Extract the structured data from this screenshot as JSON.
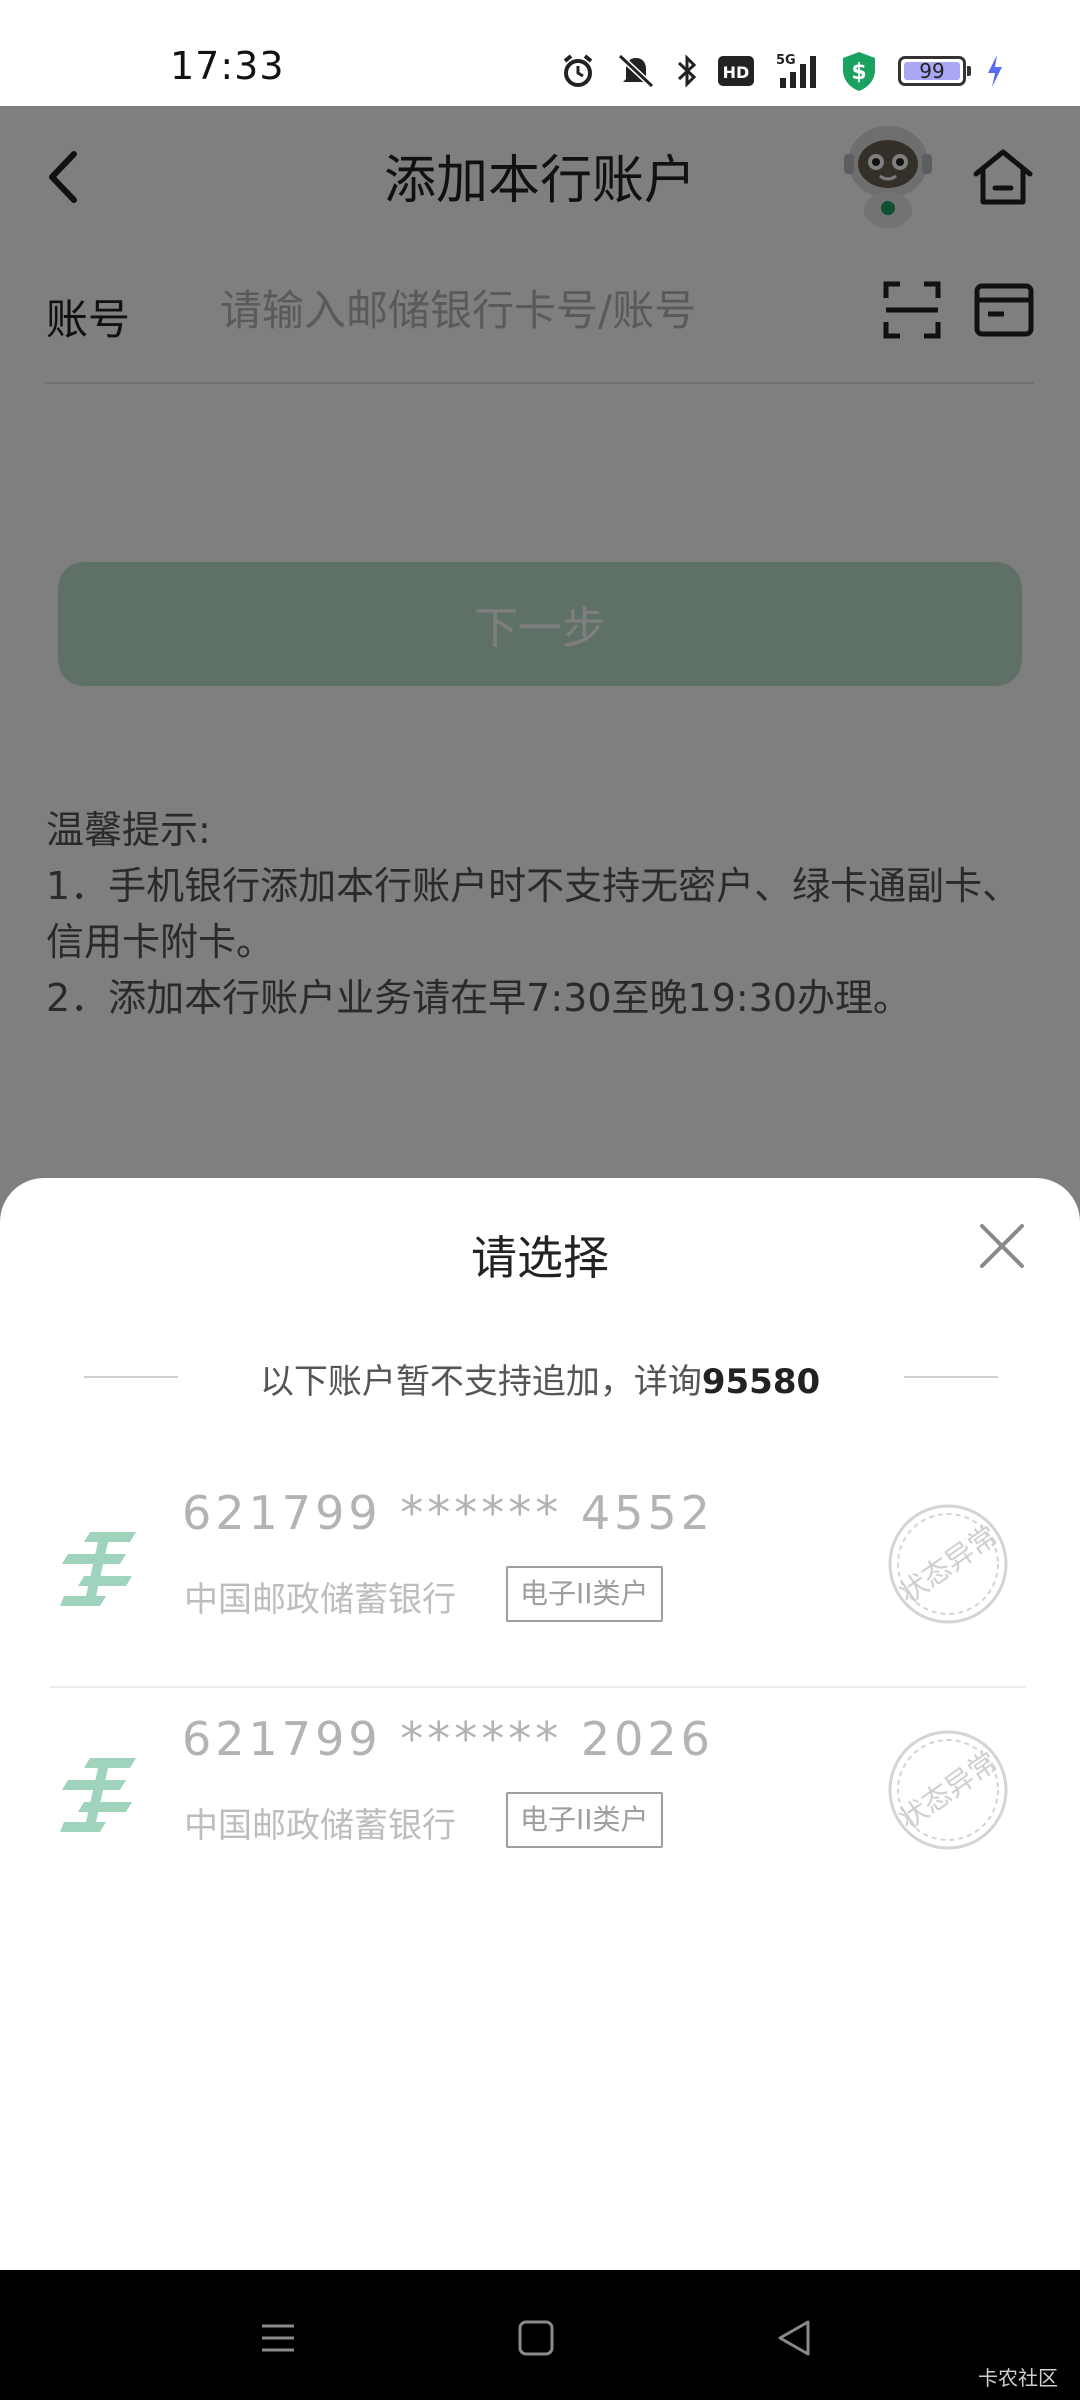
{
  "status_bar": {
    "time": "17:33",
    "network": "5G",
    "hd": "HD",
    "battery": "99",
    "icons": [
      "alarm-icon",
      "mute-icon",
      "bluetooth-icon",
      "hd-icon",
      "signal-icon",
      "shield-icon",
      "battery-icon",
      "charging-icon"
    ]
  },
  "nav": {
    "title": "添加本行账户",
    "back_icon": "chevron-left-icon",
    "home_icon": "home-icon"
  },
  "account_field": {
    "label": "账号",
    "placeholder": "请输入邮储银行卡号/账号",
    "value": ""
  },
  "next_button": {
    "label": "下一步"
  },
  "tips": {
    "heading": "温馨提示:",
    "items": [
      "1．手机银行添加本行账户时不支持无密户、绿卡通副卡、信用卡附卡。",
      "2．添加本行账户业务请在早7:30至晚19:30办理。"
    ]
  },
  "sheet": {
    "title": "请选择",
    "notice_prefix": "以下账户暂不支持追加，详询",
    "notice_phone": "95580",
    "accounts": [
      {
        "number": "621799 ****** 4552",
        "bank": "中国邮政储蓄银行",
        "type": "电子II类户",
        "status": "状态异常"
      },
      {
        "number": "621799 ****** 2026",
        "bank": "中国邮政储蓄银行",
        "type": "电子II类户",
        "status": "状态异常"
      }
    ]
  },
  "watermark": "卡农社区",
  "colors": {
    "accent_green": "#1aa260",
    "button_disabled": "#bfe0cf",
    "logo_green": "#9fd3bc"
  }
}
